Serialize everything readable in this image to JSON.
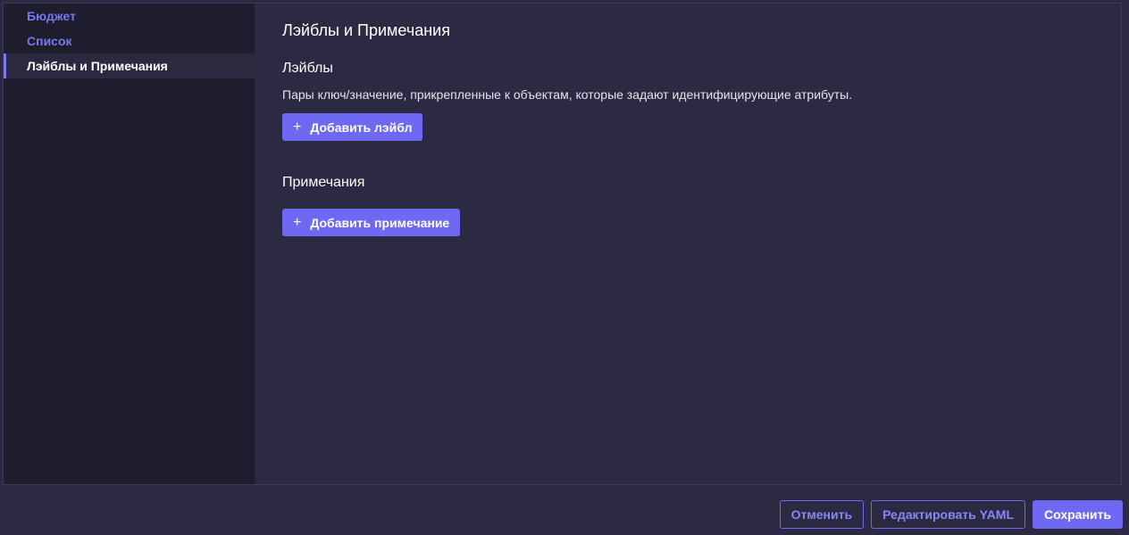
{
  "sidebar": {
    "items": [
      {
        "label": "Бюджет",
        "active": false
      },
      {
        "label": "Список",
        "active": false
      },
      {
        "label": "Лэйблы и Примечания",
        "active": true
      }
    ]
  },
  "main": {
    "title": "Лэйблы и Примечания",
    "labels": {
      "heading": "Лэйблы",
      "description": "Пары ключ/значение, прикрепленные к объектам, которые задают идентифицирующие атрибуты.",
      "add_button": "Добавить лэйбл",
      "add_icon": "+"
    },
    "annotations": {
      "heading": "Примечания",
      "add_button": "Добавить примечание",
      "add_icon": "+"
    }
  },
  "footer": {
    "cancel": "Отменить",
    "edit_yaml": "Редактировать YAML",
    "save": "Сохранить"
  },
  "colors": {
    "accent": "#6e68f3",
    "background": "#2b2a42",
    "sidebar": "#1e1d2e"
  }
}
